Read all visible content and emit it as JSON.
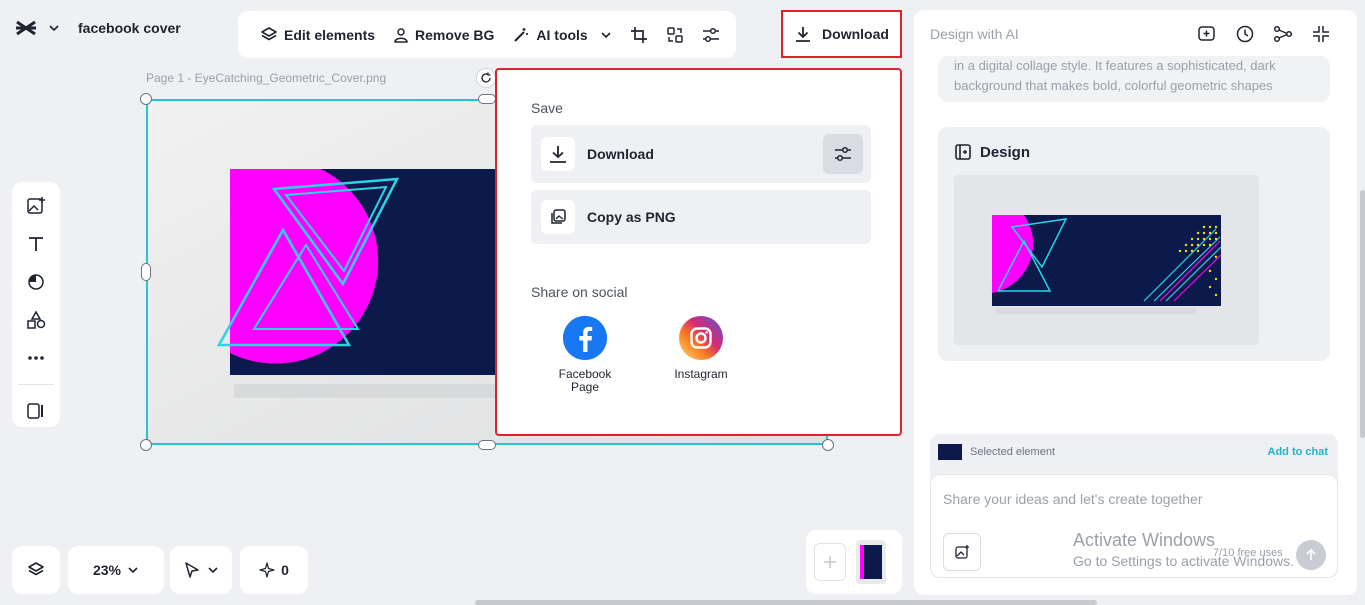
{
  "app": {
    "doc_title": "facebook cover"
  },
  "toolbar": {
    "edit_label": "Edit elements",
    "remove_bg_label": "Remove BG",
    "ai_tools_label": "AI tools",
    "download_label": "Download"
  },
  "canvas": {
    "page_label": "Page 1 -   EyeCatching_Geometric_Cover.png"
  },
  "popup": {
    "save_heading": "Save",
    "download_label": "Download",
    "copy_png_label": "Copy as PNG",
    "share_heading": "Share on social",
    "facebook_label_1": "Facebook",
    "facebook_label_2": "Page",
    "instagram_label": "Instagram"
  },
  "right_panel": {
    "header": "Design with AI",
    "faded_line1": "in a digital collage style. It features a sophisticated, dark",
    "faded_line2": "background that makes bold, colorful geometric shapes",
    "design_heading": "Design",
    "selected_label": "Selected element",
    "add_to_chat": "Add to chat",
    "placeholder": "Share your ideas and let's create together",
    "uses": "7/10 free uses"
  },
  "watermark": {
    "line1": "Activate Windows",
    "line2": "Go to Settings to activate Windows."
  },
  "bottom_bar": {
    "zoom": "23%",
    "credits": "0"
  },
  "colors": {
    "accent": "#26c3d3",
    "highlight": "#e0202a",
    "navy": "#0b1a4a",
    "magenta": "#ff00ff",
    "cyan": "#2ad4e8"
  }
}
